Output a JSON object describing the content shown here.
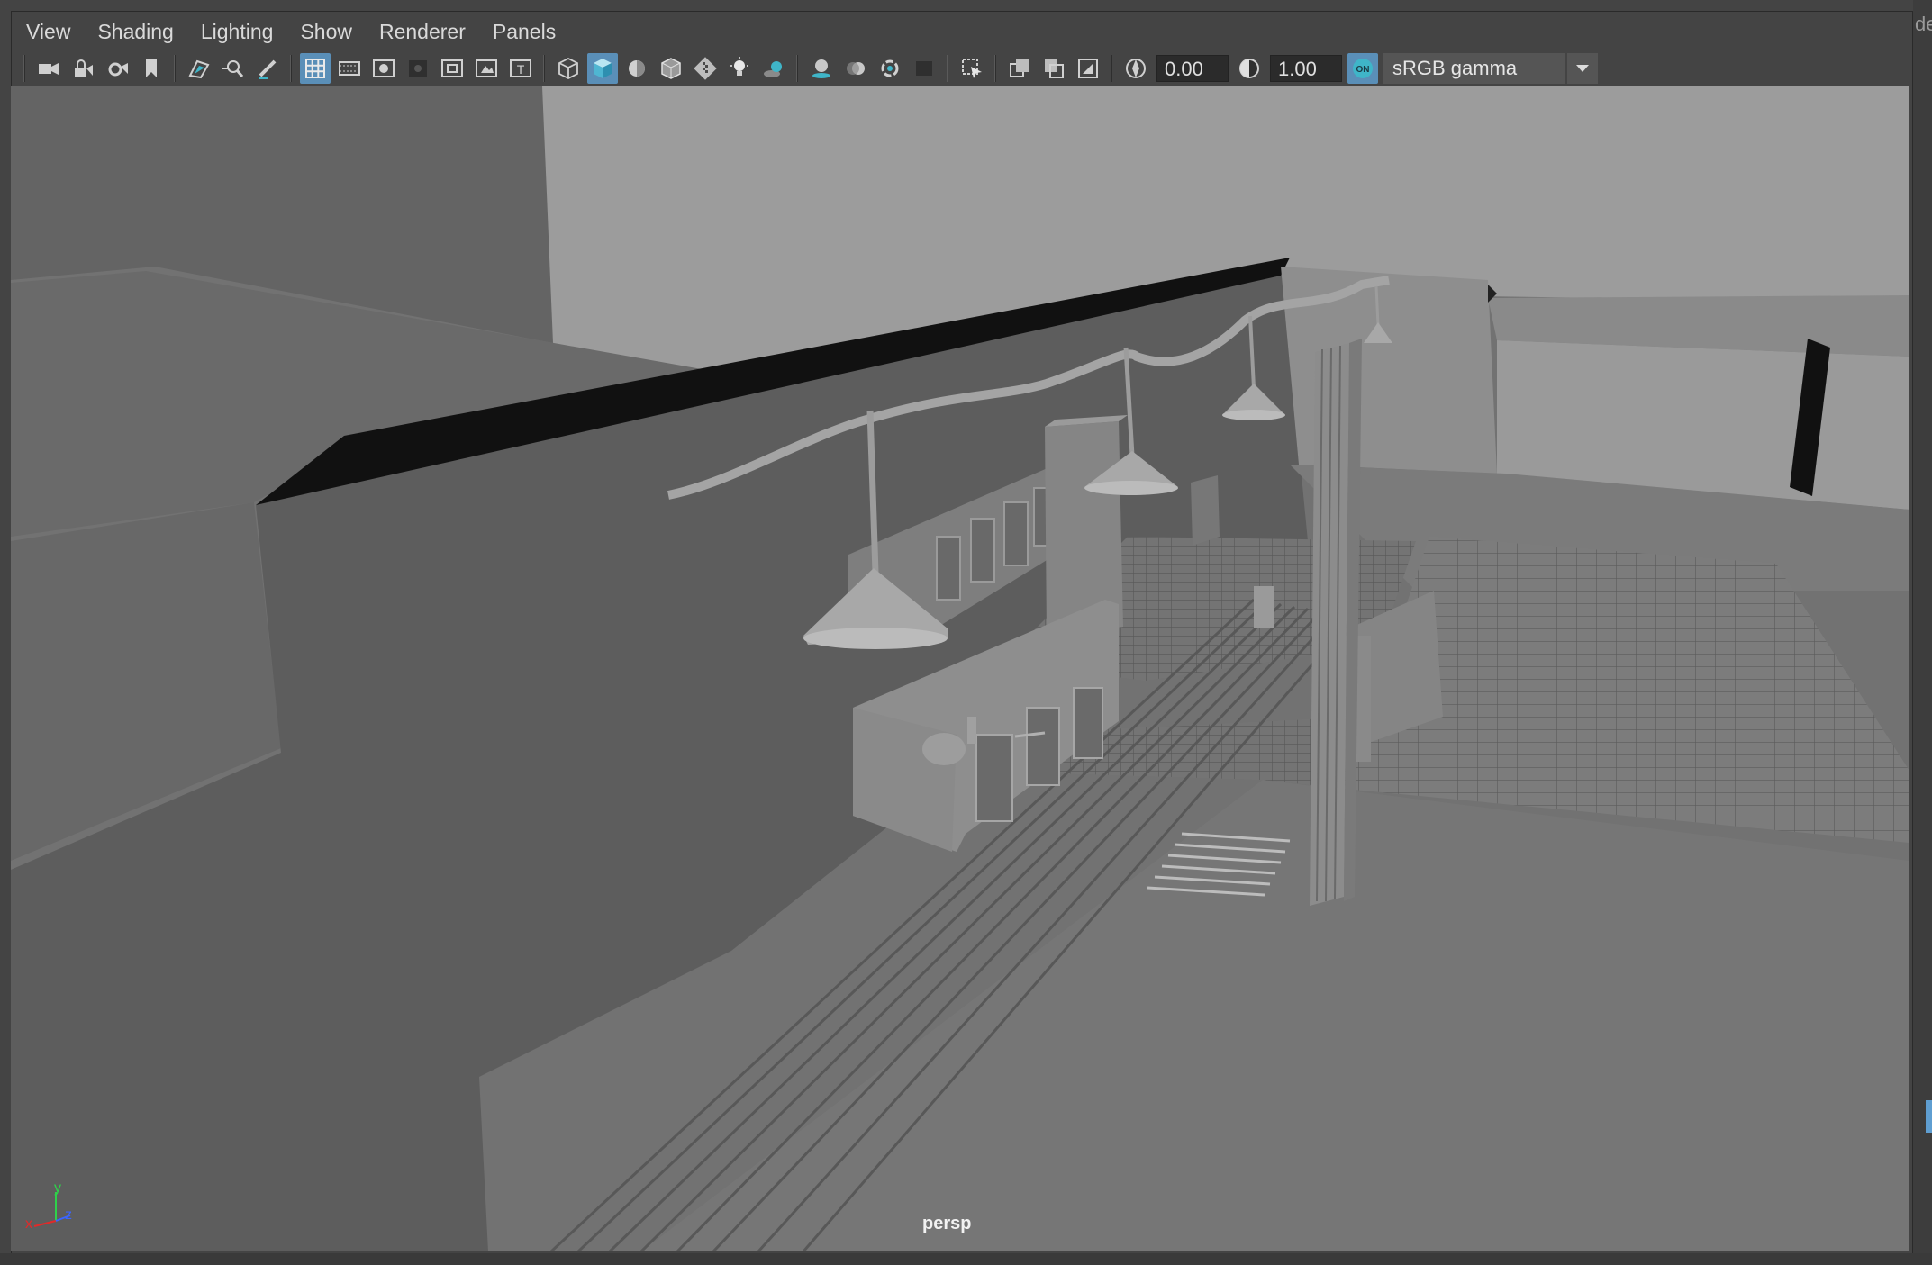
{
  "menu": [
    "View",
    "Shading",
    "Lighting",
    "Show",
    "Renderer",
    "Panels"
  ],
  "toolbar": {
    "exposure_value": "0.00",
    "gamma_value": "1.00",
    "color_management_badge": "ON",
    "color_space": "sRGB gamma",
    "icons": [
      "select-camera-icon",
      "lock-camera-icon",
      "camera-attributes-icon",
      "bookmark-icon",
      "image-plane-icon",
      "2d-pan-zoom-icon",
      "grease-pencil-icon",
      "grid-icon",
      "film-gate-icon",
      "resolution-gate-icon",
      "gate-mask-icon",
      "field-chart-icon",
      "safe-action-icon",
      "safe-title-icon",
      "wireframe-icon",
      "smooth-shade-icon",
      "default-material-icon",
      "wireframe-on-shaded-icon",
      "xray-icon",
      "use-all-lights-icon",
      "shadows-icon",
      "screen-space-ao-icon",
      "motion-blur-icon",
      "anti-aliasing-icon",
      "depth-of-field-icon",
      "isolate-select-icon",
      "xray-joints-icon",
      "backface-culling-icon",
      "shaded-selection-icon",
      "texture-icon",
      "exposure-icon",
      "gamma-icon",
      "color-management-icon"
    ]
  },
  "viewport": {
    "camera_label": "persp",
    "axis": {
      "x": "x",
      "y": "y",
      "z": "z"
    }
  },
  "right_edge_text": "de",
  "colors": {
    "accent": "#5a8fb8",
    "cm_teal": "#3fb5c8"
  }
}
